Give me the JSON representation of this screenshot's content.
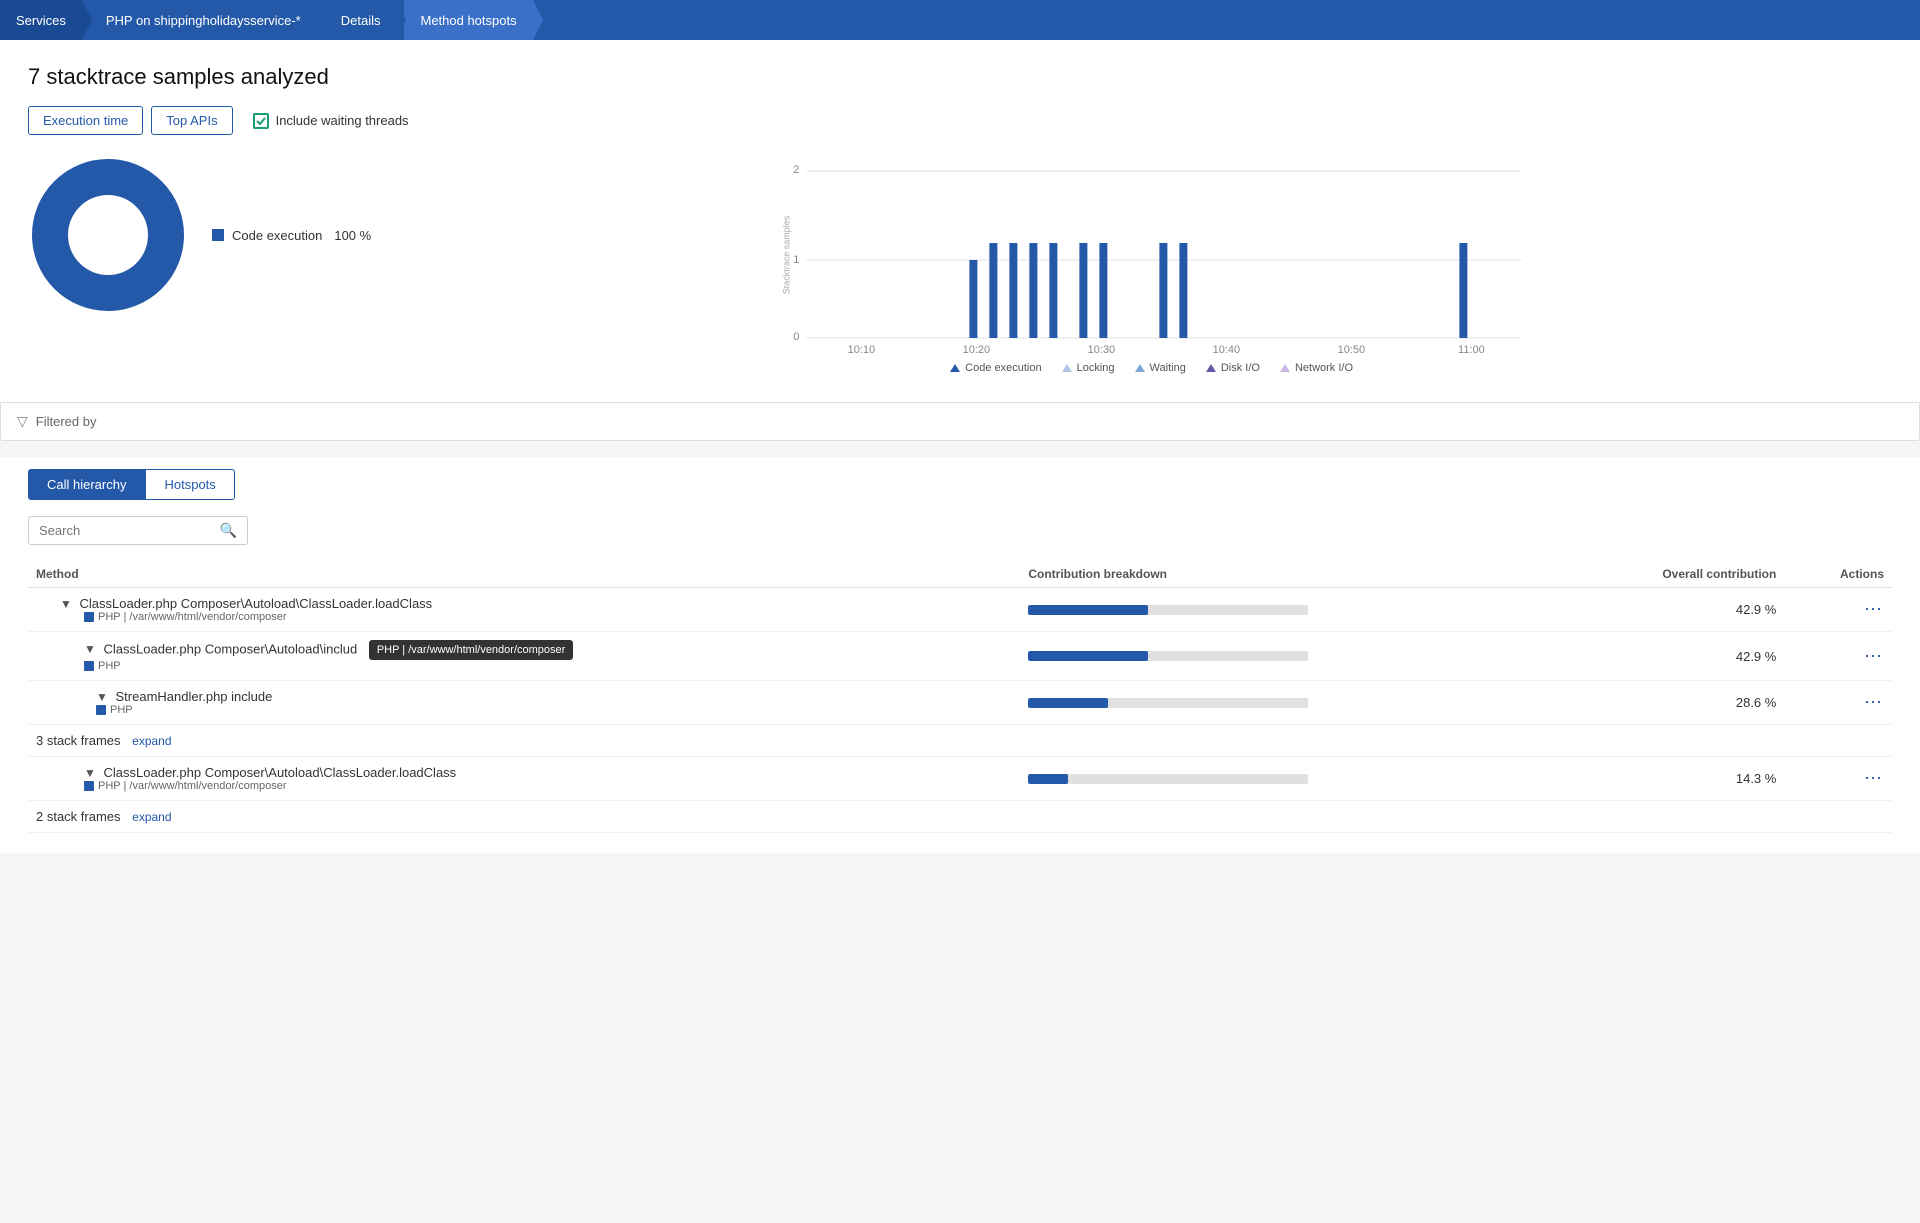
{
  "breadcrumb": {
    "items": [
      {
        "label": "Services",
        "active": false
      },
      {
        "label": "PHP on shippingholidaysservice-*",
        "active": false
      },
      {
        "label": "Details",
        "active": false
      },
      {
        "label": "Method hotspots",
        "active": true
      }
    ]
  },
  "page": {
    "title": "7 stacktrace samples analyzed",
    "tabs": [
      {
        "label": "Execution time",
        "active": true
      },
      {
        "label": "Top APIs",
        "active": false
      }
    ],
    "checkbox": {
      "label": "Include waiting threads",
      "checked": true
    }
  },
  "donut": {
    "items": [
      {
        "label": "Code execution",
        "pct": "100 %",
        "color": "#2359a8"
      }
    ]
  },
  "chart": {
    "y_label": "Stacktrace samples",
    "y_max": 2,
    "y_mid": 1,
    "y_min": 0,
    "x_labels": [
      "10:10",
      "10:20",
      "10:30",
      "10:40",
      "10:50",
      "11:00"
    ],
    "legend": [
      {
        "label": "Code execution",
        "type": "code"
      },
      {
        "label": "Locking",
        "type": "locking"
      },
      {
        "label": "Waiting",
        "type": "waiting"
      },
      {
        "label": "Disk I/O",
        "type": "disk"
      },
      {
        "label": "Network I/O",
        "type": "network"
      }
    ]
  },
  "filter": {
    "label": "Filtered by"
  },
  "hierarchy": {
    "tabs": [
      {
        "label": "Call hierarchy",
        "active": true
      },
      {
        "label": "Hotspots",
        "active": false
      }
    ],
    "search": {
      "placeholder": "Search"
    },
    "table": {
      "headers": [
        {
          "label": "Method"
        },
        {
          "label": "Contribution breakdown"
        },
        {
          "label": "Overall contribution"
        },
        {
          "label": "Actions"
        }
      ],
      "rows": [
        {
          "indent": 1,
          "chevron": true,
          "method": "ClassLoader.php Composer\\Autoload\\ClassLoader.loadClass",
          "path": "PHP | /var/www/html/vendor/composer",
          "tooltip": null,
          "pct": 42.9,
          "pct_label": "42.9 %",
          "stack_frames": null
        },
        {
          "indent": 2,
          "chevron": true,
          "method": "ClassLoader.php Composer\\Autoload\\includ",
          "path": "PHP",
          "tooltip": "PHP | /var/www/html/vendor/composer",
          "pct": 42.9,
          "pct_label": "42.9 %",
          "stack_frames": null
        },
        {
          "indent": 3,
          "chevron": true,
          "method": "StreamHandler.php include",
          "path": "PHP",
          "tooltip": null,
          "pct": 28.6,
          "pct_label": "28.6 %",
          "stack_frames": null
        },
        {
          "indent": 3,
          "chevron": false,
          "method": "3 stack frames",
          "path": null,
          "tooltip": null,
          "pct": null,
          "pct_label": null,
          "expand_label": "expand",
          "stack_frames": true
        },
        {
          "indent": 2,
          "chevron": true,
          "method": "ClassLoader.php Composer\\Autoload\\ClassLoader.loadClass",
          "path": "PHP | /var/www/html/vendor/composer",
          "tooltip": null,
          "pct": 14.3,
          "pct_label": "14.3 %",
          "stack_frames": null
        },
        {
          "indent": 2,
          "chevron": false,
          "method": "2 stack frames",
          "path": null,
          "tooltip": null,
          "pct": null,
          "pct_label": null,
          "expand_label": "expand",
          "stack_frames": true
        }
      ]
    }
  }
}
